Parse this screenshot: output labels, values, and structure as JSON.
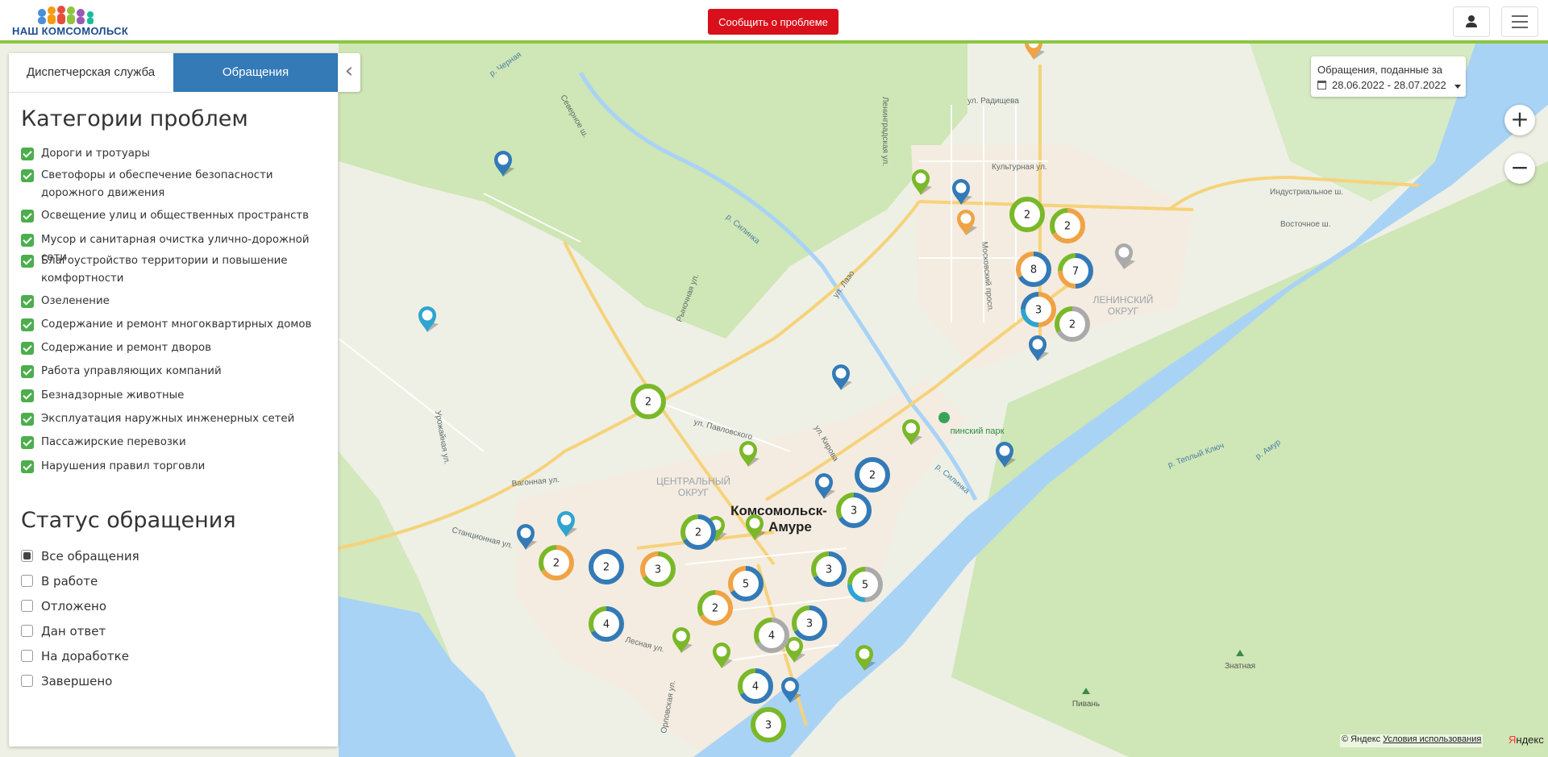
{
  "header": {
    "logo_text": "НАШ КОМСОМОЛЬСК",
    "report_button": "Сообщить о проблеме"
  },
  "sidebar": {
    "tabs": [
      {
        "label": "Диспетчерская служба",
        "active": false
      },
      {
        "label": "Обращения",
        "active": true
      }
    ],
    "categories_title": "Категории проблем",
    "categories": [
      {
        "label": "Дороги и тротуары",
        "checked": true
      },
      {
        "label": "Светофоры и обеспечение безопасности дорожного движения",
        "checked": true
      },
      {
        "label": "Освещение улиц и общественных пространств",
        "checked": true
      },
      {
        "label": "Мусор и санитарная очистка улично-дорожной сети",
        "checked": true
      },
      {
        "label": "Благоустройство территории и повышение комфортности",
        "checked": true
      },
      {
        "label": "Озеленение",
        "checked": true
      },
      {
        "label": "Содержание и ремонт многоквартирных домов",
        "checked": true
      },
      {
        "label": "Содержание и ремонт дворов",
        "checked": true
      },
      {
        "label": "Работа управляющих компаний",
        "checked": true
      },
      {
        "label": "Безнадзорные животные",
        "checked": true
      },
      {
        "label": "Эксплуатация наружных инженерных сетей",
        "checked": true
      },
      {
        "label": "Пассажирские перевозки",
        "checked": true
      },
      {
        "label": "Нарушения правил торговли",
        "checked": true
      }
    ],
    "status_title": "Статус обращения",
    "statuses": [
      {
        "label": "Все обращения",
        "selected": true
      },
      {
        "label": "В работе",
        "selected": false
      },
      {
        "label": "Отложено",
        "selected": false
      },
      {
        "label": "Дан ответ",
        "selected": false
      },
      {
        "label": "На доработке",
        "selected": false
      },
      {
        "label": "Завершено",
        "selected": false
      }
    ]
  },
  "date_filter": {
    "title": "Обращения, поданные за",
    "range": "28.06.2022 - 28.07.2022"
  },
  "zoom": {
    "in": "+",
    "out": "−"
  },
  "map_labels": {
    "city": "Комсомольск-",
    "city2": "Амуре",
    "central": "ЦЕНТРАЛЬНЫЙ",
    "central2": "ОКРУГ",
    "leninsky": "ЛЕНИНСКИЙ",
    "leninsky2": "ОКРУГ",
    "river1": "р. Теплый Ключ",
    "river2": "р. Амур",
    "silinka": "р. Силинка",
    "park": "пинский парк",
    "znatnaya": "Знатная",
    "pivan": "Пивань",
    "lazo": "ул. Лазо",
    "kirova": "ул. Кирова",
    "pavlovskogo": "ул. Павловского",
    "vagonnaya": "Вагонная ул.",
    "stantsionnaya": "Станционная ул.",
    "kulturnaya": "Культурная ул.",
    "radishcheva": "ул. Радищева",
    "industrialnoe": "Индустриальное ш.",
    "vostochnoe": "Восточное ш.",
    "severnoe": "Северное ш.",
    "chernaya": "р. Черная",
    "urozhaynaya": "Урожайная ул.",
    "leningradskaya": "Ленинградская ул.",
    "moskovsky": "Московский просп.",
    "rynochnaya": "Рыночная ул.",
    "lesnaya": "Лесная ул.",
    "orlovskaya": "Орловская ул."
  },
  "clusters": [
    {
      "count": "2"
    },
    {
      "count": "2"
    },
    {
      "count": "8"
    },
    {
      "count": "7"
    },
    {
      "count": "3"
    },
    {
      "count": "2"
    },
    {
      "count": "2"
    },
    {
      "count": "3"
    },
    {
      "count": "2"
    },
    {
      "count": "2"
    },
    {
      "count": "2"
    },
    {
      "count": "2"
    },
    {
      "count": "3"
    },
    {
      "count": "5"
    },
    {
      "count": "3"
    },
    {
      "count": "5"
    },
    {
      "count": "2"
    },
    {
      "count": "4"
    },
    {
      "count": "4"
    },
    {
      "count": "3"
    },
    {
      "count": "4"
    },
    {
      "count": "3"
    }
  ],
  "colors": {
    "blue": "#337ab7",
    "green": "#7ab829",
    "orange": "#f0a345",
    "gray": "#aaaaaa",
    "cyan": "#2fa4d1",
    "red": "#d9101b"
  },
  "copyright": {
    "text": "© Яндекс",
    "link": "Условия использования",
    "logo": "ндекс",
    "logo_y": "Я"
  }
}
